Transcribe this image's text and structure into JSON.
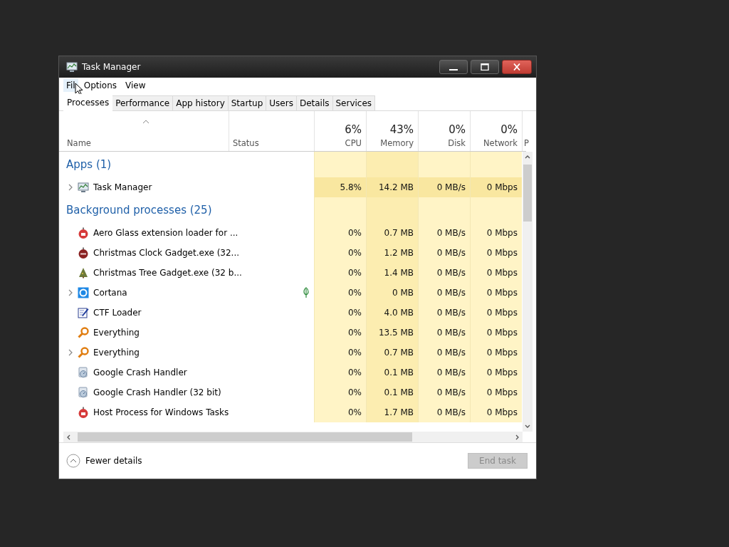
{
  "window": {
    "title": "Task Manager"
  },
  "menu": [
    {
      "label": "Fil",
      "pointer": true
    },
    {
      "label": "Options",
      "pointer": false
    },
    {
      "label": "View",
      "pointer": false
    }
  ],
  "tabs": [
    {
      "label": "Processes",
      "selected": true
    },
    {
      "label": "Performance",
      "selected": false
    },
    {
      "label": "App history",
      "selected": false
    },
    {
      "label": "Startup",
      "selected": false
    },
    {
      "label": "Users",
      "selected": false
    },
    {
      "label": "Details",
      "selected": false
    },
    {
      "label": "Services",
      "selected": false
    }
  ],
  "columns": [
    {
      "label": "Name",
      "sorted": true
    },
    {
      "label": "Status",
      "sorted": false
    },
    {
      "label": "CPU",
      "usage": "6%",
      "sorted": false
    },
    {
      "label": "Memory",
      "usage": "43%",
      "sorted": false
    },
    {
      "label": "Disk",
      "usage": "0%",
      "sorted": false
    },
    {
      "label": "Network",
      "usage": "0%",
      "sorted": false
    },
    {
      "label": "P",
      "sorted": false
    }
  ],
  "groups": [
    {
      "title": "Apps (1)",
      "rows": [
        {
          "name": "Task Manager",
          "kind": "taskmgr",
          "expandable": true,
          "efficiency": false,
          "hot": true,
          "cpu": "5.8%",
          "memory": "14.2 MB",
          "disk": "0 MB/s",
          "network": "0 Mbps"
        }
      ]
    },
    {
      "title": "Background processes (25)",
      "rows": [
        {
          "name": "Aero Glass extension loader for ...",
          "kind": "ornament",
          "expandable": false,
          "efficiency": false,
          "hot": false,
          "cpu": "0%",
          "memory": "0.7 MB",
          "disk": "0 MB/s",
          "network": "0 Mbps"
        },
        {
          "name": "Christmas Clock Gadget.exe (32...",
          "kind": "ornament_dark",
          "expandable": false,
          "efficiency": false,
          "hot": false,
          "cpu": "0%",
          "memory": "1.2 MB",
          "disk": "0 MB/s",
          "network": "0 Mbps"
        },
        {
          "name": "Christmas Tree Gadget.exe (32 b...",
          "kind": "tree",
          "expandable": false,
          "efficiency": false,
          "hot": false,
          "cpu": "0%",
          "memory": "1.4 MB",
          "disk": "0 MB/s",
          "network": "0 Mbps"
        },
        {
          "name": "Cortana",
          "kind": "cortana",
          "expandable": true,
          "efficiency": true,
          "hot": false,
          "cpu": "0%",
          "memory": "0 MB",
          "disk": "0 MB/s",
          "network": "0 Mbps"
        },
        {
          "name": "CTF Loader",
          "kind": "ctf",
          "expandable": false,
          "efficiency": false,
          "hot": false,
          "cpu": "0%",
          "memory": "4.0 MB",
          "disk": "0 MB/s",
          "network": "0 Mbps"
        },
        {
          "name": "Everything",
          "kind": "key",
          "expandable": false,
          "efficiency": false,
          "hot": false,
          "cpu": "0%",
          "memory": "13.5 MB",
          "disk": "0 MB/s",
          "network": "0 Mbps"
        },
        {
          "name": "Everything",
          "kind": "key",
          "expandable": true,
          "efficiency": false,
          "hot": false,
          "cpu": "0%",
          "memory": "0.7 MB",
          "disk": "0 MB/s",
          "network": "0 Mbps"
        },
        {
          "name": "Google Crash Handler",
          "kind": "crash",
          "expandable": false,
          "efficiency": false,
          "hot": false,
          "cpu": "0%",
          "memory": "0.1 MB",
          "disk": "0 MB/s",
          "network": "0 Mbps"
        },
        {
          "name": "Google Crash Handler (32 bit)",
          "kind": "crash",
          "expandable": false,
          "efficiency": false,
          "hot": false,
          "cpu": "0%",
          "memory": "0.1 MB",
          "disk": "0 MB/s",
          "network": "0 Mbps"
        },
        {
          "name": "Host Process for Windows Tasks",
          "kind": "ornament",
          "expandable": false,
          "efficiency": false,
          "hot": false,
          "cpu": "0%",
          "memory": "1.7 MB",
          "disk": "0 MB/s",
          "network": "0 Mbps"
        }
      ]
    }
  ],
  "footer": {
    "toggle": "Fewer details",
    "button": {
      "label": "End task",
      "disabled": true
    }
  }
}
